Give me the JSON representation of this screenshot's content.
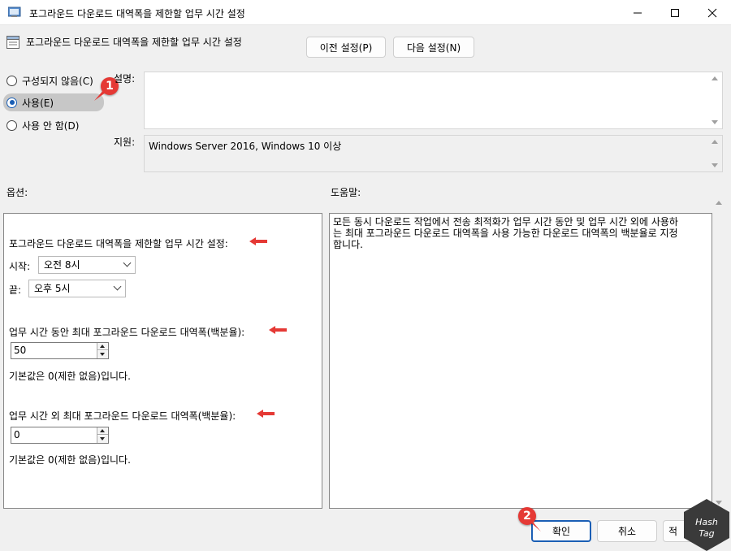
{
  "window": {
    "title": "포그라운드 다운로드 대역폭을 제한할 업무 시간 설정"
  },
  "header": {
    "title": "포그라운드 다운로드 대역폭을 제한할 업무 시간 설정",
    "prev_label": "이전 설정(P)",
    "next_label": "다음 설정(N)"
  },
  "state": {
    "options": [
      "구성되지 않음(C)",
      "사용(E)",
      "사용 안 함(D)"
    ],
    "selected": "사용(E)"
  },
  "description_label": "설명:",
  "supported_label": "지원:",
  "supported_value": "Windows Server 2016, Windows 10 이상",
  "options_label": "옵션:",
  "help_label": "도움말:",
  "options": {
    "heading": "포그라운드 다운로드 대역폭을 제한할 업무 시간 설정:",
    "start_label": "시작:",
    "start_value": "오전 8시",
    "end_label": "끝:",
    "end_value": "오후 5시",
    "max_during_label": "업무 시간 동안 최대 포그라운드 다운로드 대역폭(백분율):",
    "max_during_value": "50",
    "default_note_1": "기본값은 0(제한 없음)입니다.",
    "max_outside_label": "업무 시간 외 최대 포그라운드 다운로드 대역폭(백분율):",
    "max_outside_value": "0",
    "default_note_2": "기본값은 0(제한 없음)입니다."
  },
  "help": {
    "line1": "모든 동시 다운로드 작업에서 전송 최적화가 업무 시간 동안 및 업무 시간 외에 사용하",
    "line2": "는 최대 포그라운드 다운로드 대역폭을 사용 가능한 다운로드 대역폭의 백분율로 지정",
    "line3": "합니다."
  },
  "footer": {
    "ok_label": "확인",
    "cancel_label": "취소",
    "apply_label": "적"
  },
  "annotations": {
    "badge1": "1",
    "badge2": "2"
  },
  "watermark": {
    "line1": "Hash",
    "line2": "Tag"
  },
  "colors": {
    "accent": "#1b5fb5",
    "annotation": "#e53935"
  }
}
